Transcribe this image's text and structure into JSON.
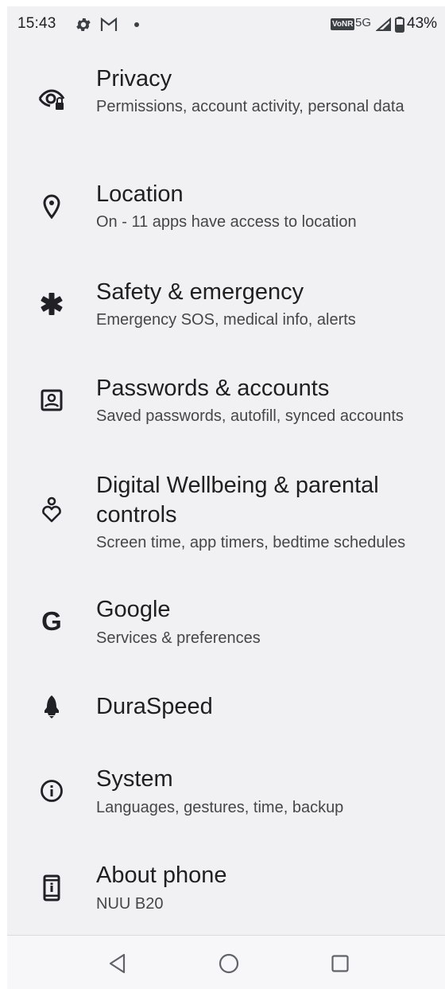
{
  "status_bar": {
    "time": "15:43",
    "network_badge": "VoNR",
    "network_type": "5G",
    "battery": "43%"
  },
  "settings": {
    "items": [
      {
        "icon": "privacy-eye-lock-icon",
        "title": "Privacy",
        "subtitle": "Permissions, account activity, personal data"
      },
      {
        "icon": "location-pin-icon",
        "title": "Location",
        "subtitle": "On - 11 apps have access to location"
      },
      {
        "icon": "asterisk-emergency-icon",
        "title": "Safety & emergency",
        "subtitle": "Emergency SOS, medical info, alerts"
      },
      {
        "icon": "account-box-icon",
        "title": "Passwords & accounts",
        "subtitle": "Saved passwords, autofill, synced accounts"
      },
      {
        "icon": "wellbeing-heart-icon",
        "title": "Digital Wellbeing & parental controls",
        "subtitle": "Screen time, app timers, bedtime schedules"
      },
      {
        "icon": "google-g-icon",
        "title": "Google",
        "subtitle": "Services & preferences"
      },
      {
        "icon": "rocket-icon",
        "title": "DuraSpeed",
        "subtitle": ""
      },
      {
        "icon": "info-circle-icon",
        "title": "System",
        "subtitle": "Languages, gestures, time, backup"
      },
      {
        "icon": "phone-info-icon",
        "title": "About phone",
        "subtitle": "NUU B20"
      }
    ]
  },
  "google_letter": "G",
  "nav": {
    "back": "back-triangle-icon",
    "home": "home-circle-icon",
    "recents": "recents-square-icon"
  },
  "colors": {
    "background": "#f1f1f4",
    "title": "#1f1f1f",
    "subtitle": "#444746",
    "icon": "#202124"
  }
}
